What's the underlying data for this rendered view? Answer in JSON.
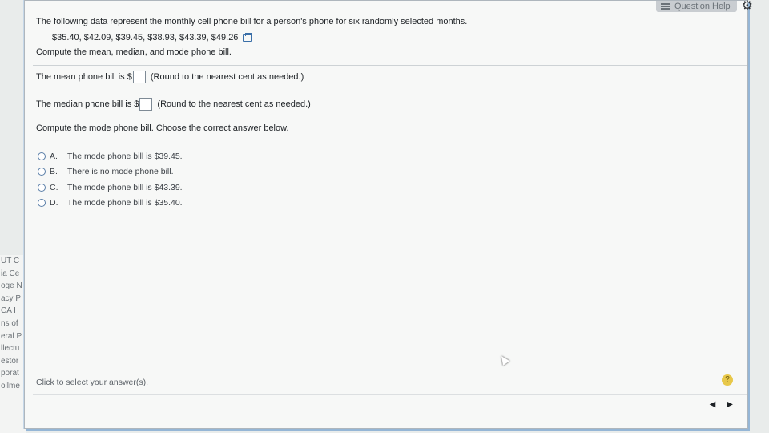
{
  "toolbar": {
    "help_label": "Question Help",
    "help_icon": "list-icon",
    "settings_icon": "gear-icon"
  },
  "background_sidebar": [
    "UT C",
    "ia Ce",
    "oge N",
    "acy P",
    "CA I",
    "ns of",
    "eral P",
    "llectu",
    "estor",
    "porat",
    "ollme"
  ],
  "question": {
    "text": "The following data represent the monthly cell phone bill for a person's phone for six randomly selected months.",
    "data": "$35.40, $42.09, $39.45, $38.93, $43.39, $49.26",
    "instruction": "Compute the mean, median, and mode phone bill."
  },
  "answers": {
    "mean_label": "The mean phone bill is $",
    "mean_value": "",
    "mean_hint": "(Round to the nearest cent as needed.)",
    "median_label": "The median phone bill is $",
    "median_value": "",
    "median_hint": "(Round to the nearest cent as needed.)"
  },
  "mode_prompt": "Compute the mode phone bill. Choose the correct answer below.",
  "options": [
    {
      "letter": "A.",
      "text": "The mode phone bill is $39.45."
    },
    {
      "letter": "B.",
      "text": "There is no mode phone bill."
    },
    {
      "letter": "C.",
      "text": "The mode phone bill is $43.39."
    },
    {
      "letter": "D.",
      "text": "The mode phone bill is $35.40."
    }
  ],
  "status": {
    "text": "Click to select your answer(s).",
    "help_symbol": "?",
    "prev_symbol": "◀",
    "next_symbol": "▶"
  },
  "colors": {
    "panel_border": "#aeb6bd",
    "radio_border": "#5a7ea8",
    "help_circle": "#e8c84a"
  }
}
